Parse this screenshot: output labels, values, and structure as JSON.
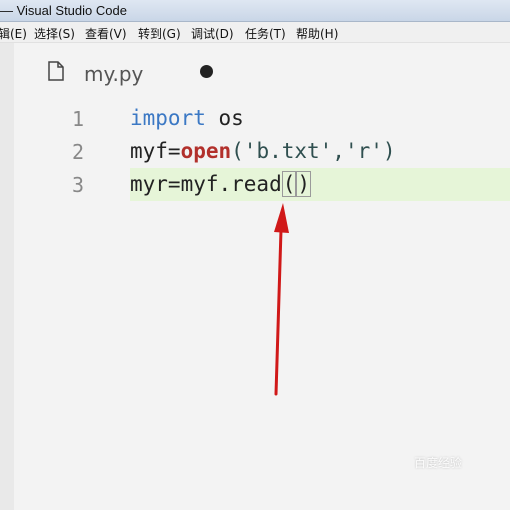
{
  "window": {
    "title": "— Visual Studio Code"
  },
  "menubar": {
    "items": [
      "辑(E)",
      "选择(S)",
      "查看(V)",
      "转到(G)",
      "调试(D)",
      "任务(T)",
      "帮助(H)"
    ]
  },
  "tab": {
    "label": "my.py",
    "modified": true
  },
  "editor": {
    "line_numbers": [
      "1",
      "2",
      "3"
    ],
    "lines": [
      {
        "kw": "import",
        "rest": " os"
      },
      {
        "pre": "myf=",
        "fn": "open",
        "args": "('b.txt','r')"
      },
      {
        "pre": "myr=myf.read",
        "open": "(",
        "close": ")"
      }
    ]
  },
  "colors": {
    "keyword": "#3b78c4",
    "builtin": "#b2302b",
    "highlight": "#e6f5d8",
    "arrow": "#d01818"
  },
  "watermark": {
    "text": "百度经验"
  }
}
